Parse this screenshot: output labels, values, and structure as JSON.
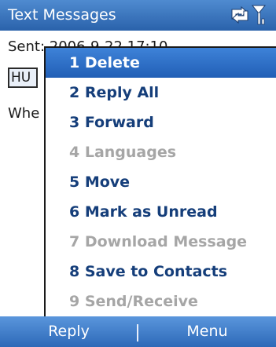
{
  "titlebar": {
    "title": "Text Messages",
    "icons": [
      "data-connection-icon",
      "signal-strength-icon"
    ]
  },
  "message": {
    "sent_label": "Sent: 2006-9-22 17:10",
    "from_initials": "HU",
    "body_preview": "Whe"
  },
  "menu": {
    "items": [
      {
        "label": "1 Delete",
        "state": "selected"
      },
      {
        "label": "2 Reply All",
        "state": "enabled"
      },
      {
        "label": "3 Forward",
        "state": "enabled"
      },
      {
        "label": "4 Languages",
        "state": "disabled"
      },
      {
        "label": "5 Move",
        "state": "enabled"
      },
      {
        "label": "6 Mark as Unread",
        "state": "enabled"
      },
      {
        "label": "7 Download Message",
        "state": "disabled"
      },
      {
        "label": "8 Save to Contacts",
        "state": "enabled"
      },
      {
        "label": "9 Send/Receive",
        "state": "disabled"
      }
    ]
  },
  "softkeys": {
    "left": "Reply",
    "right": "Menu"
  },
  "colors": {
    "accent": "#2a62ab",
    "menu_text": "#153e7a",
    "disabled_text": "#a6a6a6"
  }
}
